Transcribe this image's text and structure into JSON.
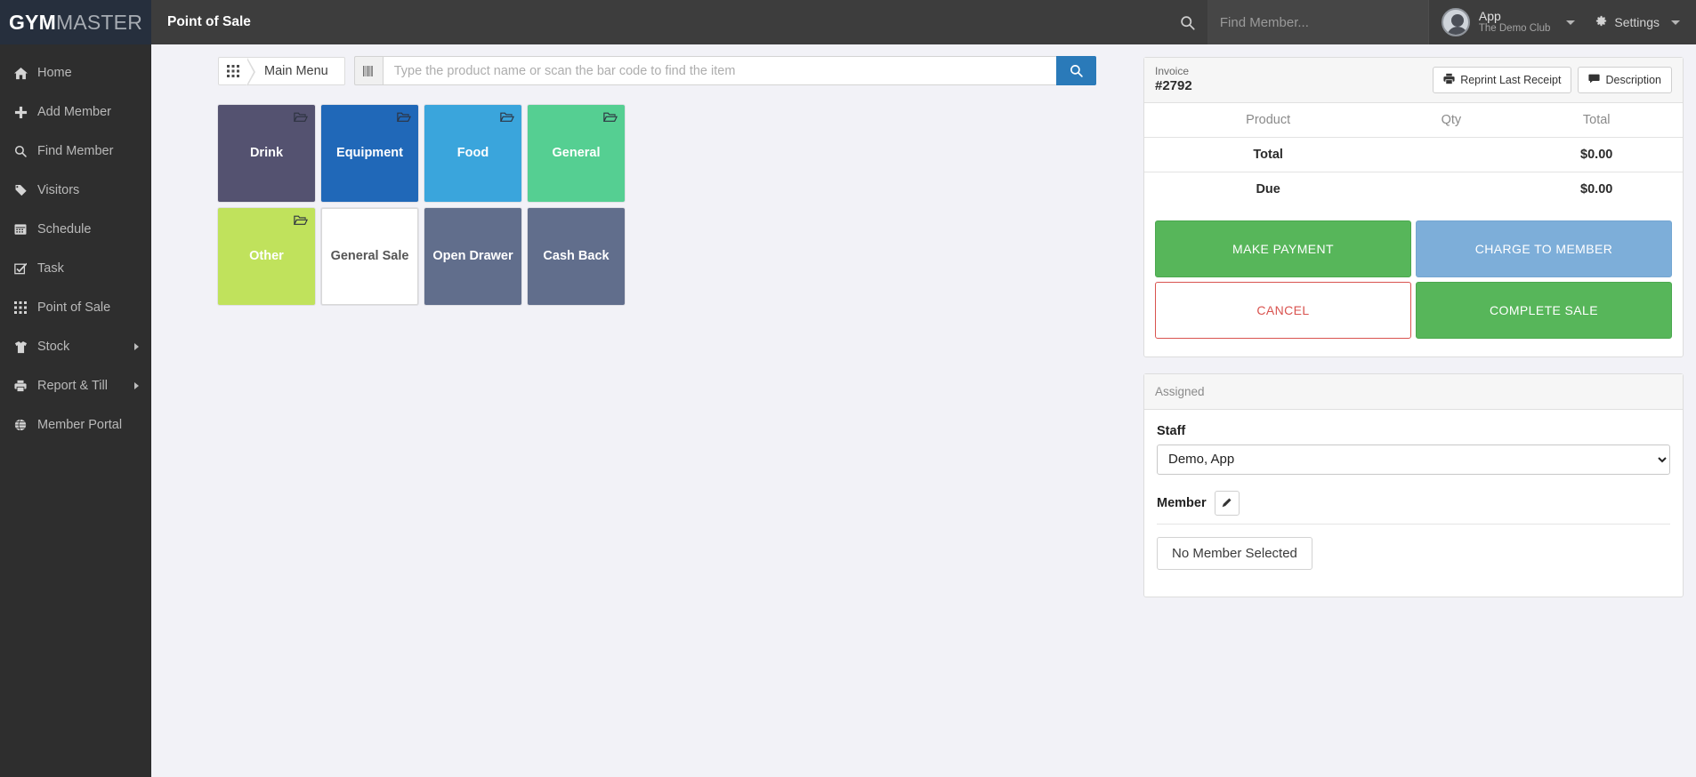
{
  "topbar": {
    "brand_bold": "GYM",
    "brand_light": "MASTER",
    "page_title": "Point of Sale",
    "member_search_placeholder": "Find Member...",
    "member_search_value": "",
    "user_name": "App",
    "user_club": "The Demo Club",
    "settings_label": "Settings",
    "accent_dark": "#262f3d",
    "bar_bg": "#3d3d3d"
  },
  "sidebar": {
    "items": [
      {
        "label": "Home",
        "icon": "home-icon",
        "glyph": "⌂",
        "has_arrow": false
      },
      {
        "label": "Add Member",
        "icon": "plus-icon",
        "glyph": "✚",
        "has_arrow": false
      },
      {
        "label": "Find Member",
        "icon": "search-icon",
        "glyph": "🔍",
        "has_arrow": false
      },
      {
        "label": "Visitors",
        "icon": "tags-icon",
        "glyph": "🏷",
        "has_arrow": false
      },
      {
        "label": "Schedule",
        "icon": "calendar-icon",
        "glyph": "📅",
        "has_arrow": false
      },
      {
        "label": "Task",
        "icon": "check-square-icon",
        "glyph": "☑",
        "has_arrow": false
      },
      {
        "label": "Point of Sale",
        "icon": "grid-icon",
        "glyph": "☷",
        "has_arrow": false
      },
      {
        "label": "Stock",
        "icon": "shirt-icon",
        "glyph": "👕",
        "has_arrow": true
      },
      {
        "label": "Report & Till",
        "icon": "printer-icon",
        "glyph": "🖨",
        "has_arrow": true
      },
      {
        "label": "Member Portal",
        "icon": "globe-icon",
        "glyph": "🌐",
        "has_arrow": false
      }
    ]
  },
  "toolbar": {
    "breadcrumb_label": "Main Menu",
    "breadcrumb_icon": "grid-icon",
    "barcode_icon": "barcode-icon",
    "product_search_placeholder": "Type the product name or scan the bar code to find the item",
    "product_search_value": "",
    "search_button_icon": "search-icon",
    "search_button_color": "#2a7ab9"
  },
  "tiles": [
    {
      "label": "Drink",
      "color": "#545270",
      "folder": true,
      "light": false
    },
    {
      "label": "Equipment",
      "color": "#2068b8",
      "folder": true,
      "light": false
    },
    {
      "label": "Food",
      "color": "#3aa5dc",
      "folder": true,
      "light": false
    },
    {
      "label": "General",
      "color": "#55cf92",
      "folder": true,
      "light": false
    },
    {
      "label": "Other",
      "color": "#c0e25c",
      "folder": true,
      "light": false
    },
    {
      "label": "General Sale",
      "color": "#ffffff",
      "folder": false,
      "light": true
    },
    {
      "label": "Open Drawer",
      "color": "#616e8c",
      "folder": false,
      "light": false
    },
    {
      "label": "Cash Back",
      "color": "#616e8c",
      "folder": false,
      "light": false
    }
  ],
  "invoice": {
    "label": "Invoice",
    "number": "#2792",
    "reprint_label": "Reprint Last Receipt",
    "reprint_icon": "printer-icon",
    "description_label": "Description",
    "description_icon": "comment-icon",
    "columns": [
      "Product",
      "Qty",
      "Total"
    ],
    "rows": [
      {
        "product": "Total",
        "qty": "",
        "total": "$0.00"
      },
      {
        "product": "Due",
        "qty": "",
        "total": "$0.00"
      }
    ],
    "actions": [
      {
        "label": "MAKE PAYMENT",
        "style": "green"
      },
      {
        "label": "CHARGE TO MEMBER",
        "style": "blue"
      },
      {
        "label": "CANCEL",
        "style": "cancel"
      },
      {
        "label": "COMPLETE SALE",
        "style": "green"
      }
    ],
    "colors": {
      "green": "#57b65a",
      "blue": "#7daed9",
      "cancel_text": "#d9534f"
    }
  },
  "assigned": {
    "title": "Assigned",
    "staff_label": "Staff",
    "staff_value": "Demo, App",
    "member_label": "Member",
    "edit_icon": "pencil-icon",
    "no_member_label": "No Member Selected"
  }
}
